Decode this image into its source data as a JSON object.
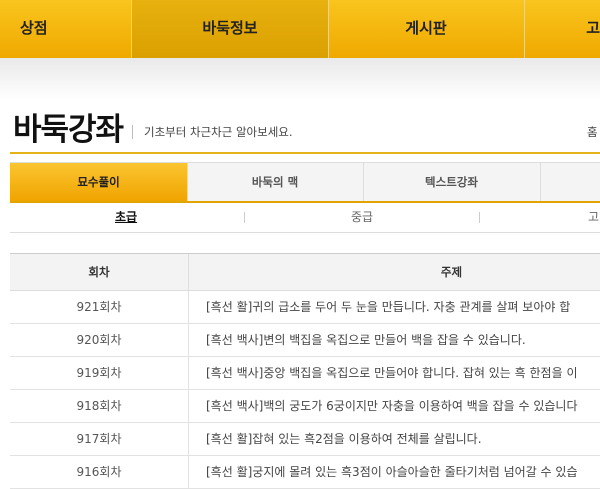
{
  "topnav": {
    "items": [
      {
        "label": "상점"
      },
      {
        "label": "바둑정보"
      },
      {
        "label": "게시판"
      },
      {
        "label": "고"
      }
    ]
  },
  "header": {
    "title": "바둑강좌",
    "subtitle": "기초부터 차근차근 알아보세요.",
    "breadcrumb": "홈"
  },
  "tabs": [
    {
      "label": "묘수풀이"
    },
    {
      "label": "바둑의 맥"
    },
    {
      "label": "텍스트강좌"
    },
    {
      "label": ""
    }
  ],
  "subtabs": [
    {
      "label": "초급"
    },
    {
      "label": "중급"
    },
    {
      "label": "고"
    }
  ],
  "table": {
    "headers": {
      "episode": "회차",
      "topic": "주제"
    },
    "rows": [
      {
        "episode": "921회차",
        "topic": "[흑선 활]귀의 급소를 두어 두 눈을 만듭니다. 자충 관계를 살펴 보아야 합"
      },
      {
        "episode": "920회차",
        "topic": "[흑선 백사]변의 백집을 옥집으로 만들어 백을 잡을 수 있습니다."
      },
      {
        "episode": "919회차",
        "topic": "[흑선 백사]중앙 백집을 옥집으로 만들어야 합니다. 잡혀 있는 흑 한점을 이"
      },
      {
        "episode": "918회차",
        "topic": "[흑선 백사]백의 궁도가 6궁이지만 자충을 이용하여 백을 잡을 수 있습니다"
      },
      {
        "episode": "917회차",
        "topic": "[흑선 활]잡혀 있는 흑2점을 이용하여 전체를 살립니다."
      },
      {
        "episode": "916회차",
        "topic": "[흑선 활]궁지에 몰려 있는 흑3점이 아슬아슬한 줄타기처럼 넘어갈 수 있습"
      }
    ]
  },
  "colors": {
    "accent": "#f0a800",
    "accent_light": "#f9c51e"
  }
}
